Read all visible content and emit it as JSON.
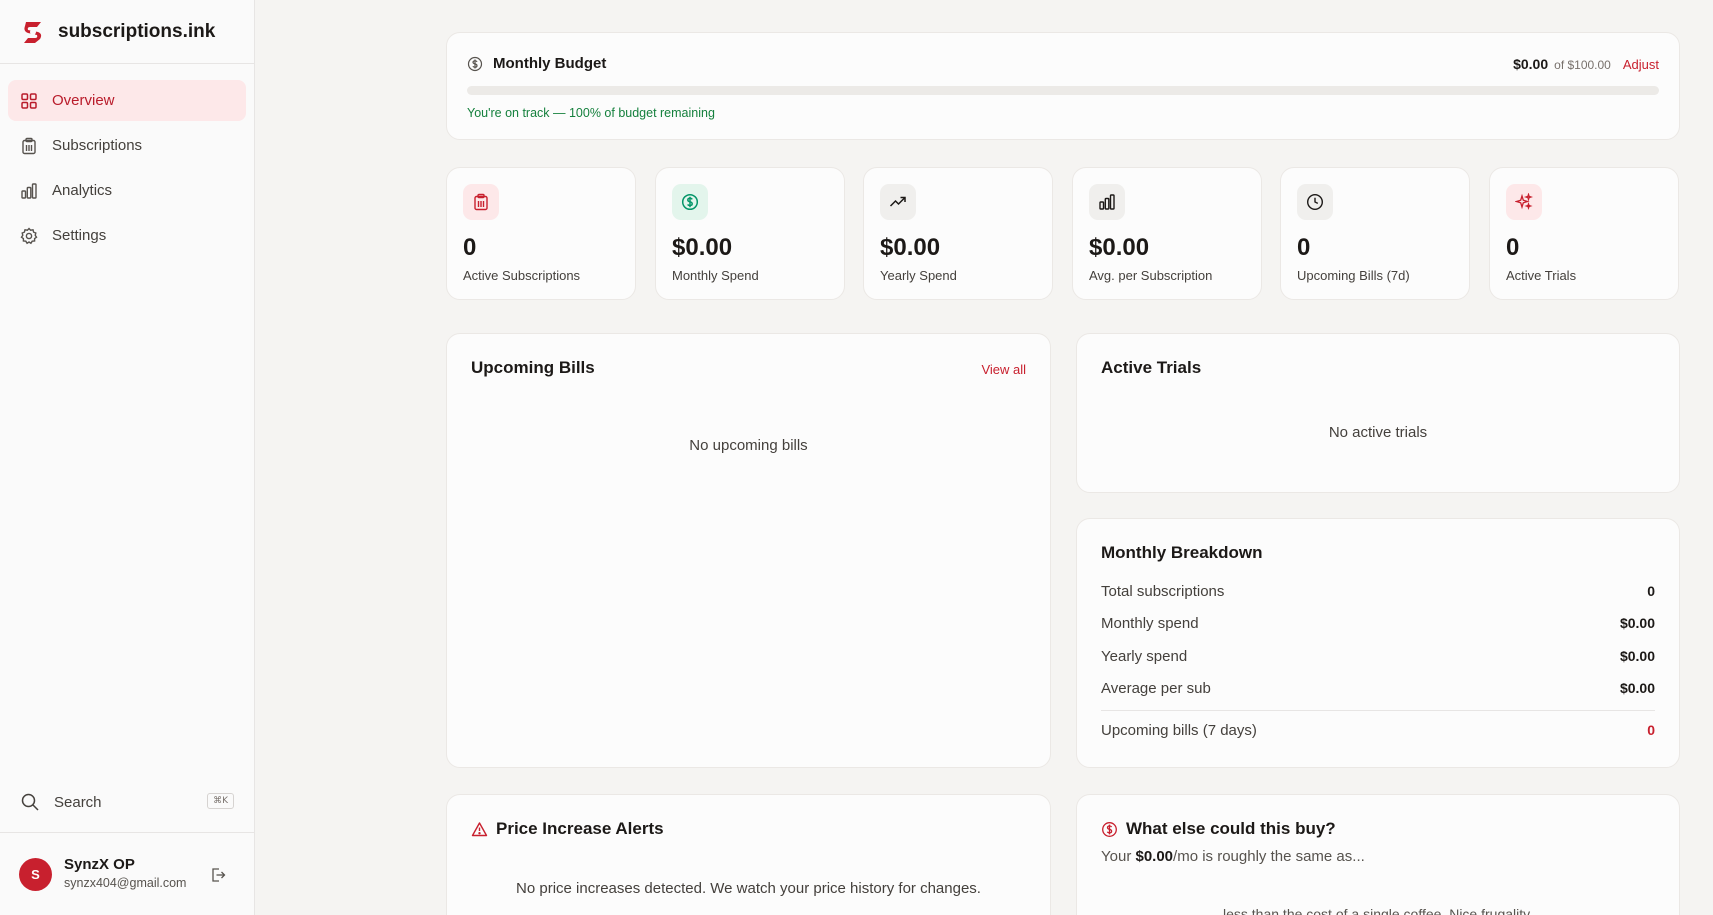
{
  "app": {
    "name": "subscriptions.ink",
    "brand_color": "#c8202e"
  },
  "sidebar": {
    "items": [
      {
        "label": "Overview",
        "icon": "grid-icon",
        "active": true
      },
      {
        "label": "Subscriptions",
        "icon": "clipboard-icon",
        "active": false
      },
      {
        "label": "Analytics",
        "icon": "bar-chart-icon",
        "active": false
      },
      {
        "label": "Settings",
        "icon": "gear-icon",
        "active": false
      }
    ],
    "search": {
      "label": "Search",
      "shortcut": "⌘K"
    },
    "user": {
      "initial": "S",
      "name": "SynzX OP",
      "email": "synzx404@gmail.com"
    }
  },
  "budget": {
    "title": "Monthly Budget",
    "amount": "$0.00",
    "of_text": "of $100.00",
    "adjust": "Adjust",
    "used_fraction": 0,
    "status": "You're on track — 100% of budget remaining"
  },
  "stats": [
    {
      "value": "0",
      "label": "Active Subscriptions",
      "icon": "clipboard-icon",
      "color": "#c8202e",
      "bg": "#fde8e9"
    },
    {
      "value": "$0.00",
      "label": "Monthly Spend",
      "icon": "dollar-circle-icon",
      "color": "#059669",
      "bg": "#e3f5ec"
    },
    {
      "value": "$0.00",
      "label": "Yearly Spend",
      "icon": "trending-up-icon",
      "color": "#1c1917",
      "bg": "#f0efed"
    },
    {
      "value": "$0.00",
      "label": "Avg. per Subscription",
      "icon": "bar-chart-icon",
      "color": "#1c1917",
      "bg": "#f0efed"
    },
    {
      "value": "0",
      "label": "Upcoming Bills (7d)",
      "icon": "clock-icon",
      "color": "#1c1917",
      "bg": "#f0efed"
    },
    {
      "value": "0",
      "label": "Active Trials",
      "icon": "sparkles-icon",
      "color": "#c8202e",
      "bg": "#fde8e9"
    }
  ],
  "upcoming": {
    "title": "Upcoming Bills",
    "view_all": "View all",
    "empty": "No upcoming bills"
  },
  "trials": {
    "title": "Active Trials",
    "empty": "No active trials"
  },
  "breakdown": {
    "title": "Monthly Breakdown",
    "rows": [
      {
        "label": "Total subscriptions",
        "value": "0"
      },
      {
        "label": "Monthly spend",
        "value": "$0.00"
      },
      {
        "label": "Yearly spend",
        "value": "$0.00"
      },
      {
        "label": "Average per sub",
        "value": "$0.00"
      }
    ],
    "upcoming_label": "Upcoming bills (7 days)",
    "upcoming_value": "0"
  },
  "alerts": {
    "title": "Price Increase Alerts",
    "empty": "No price increases detected. We watch your price history for changes."
  },
  "buy": {
    "title": "What else could this buy?",
    "prefix": "Your ",
    "amount": "$0.00",
    "suffix": "/mo is roughly the same as...",
    "extra": "less than the cost of a single coffee. Nice frugality."
  }
}
